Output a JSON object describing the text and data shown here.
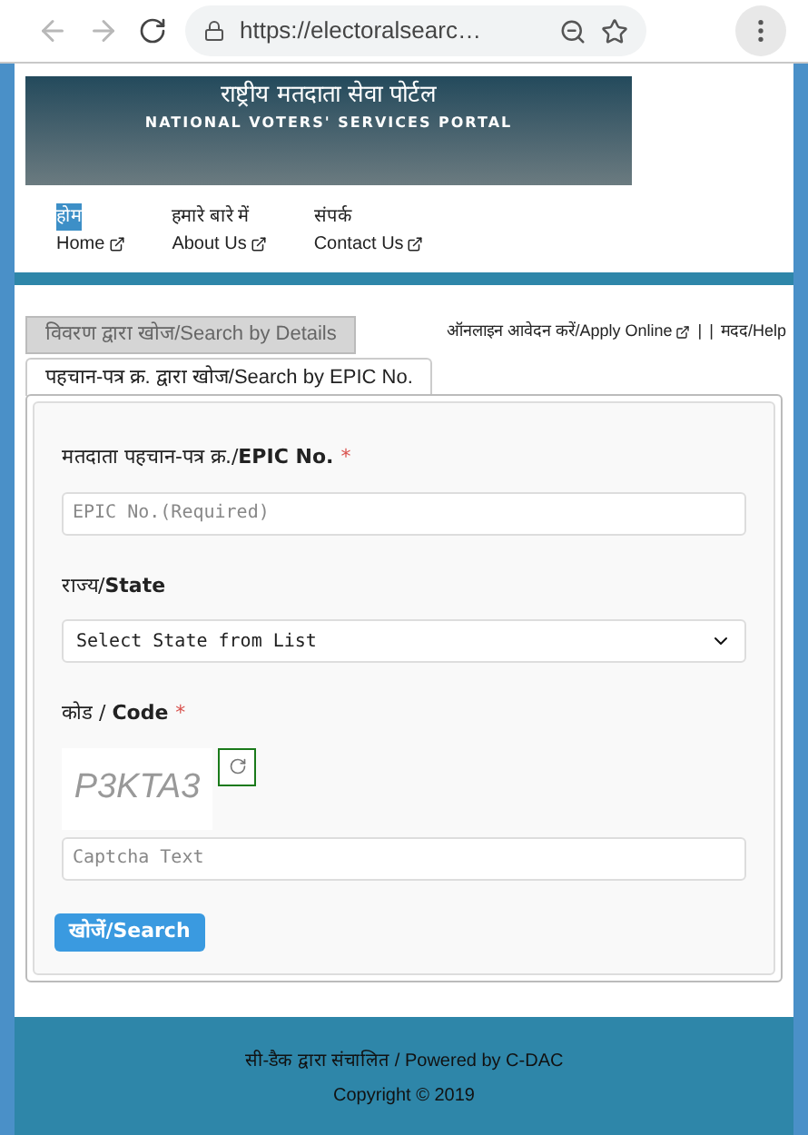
{
  "browser": {
    "url": "https://electoralsearc…",
    "back_disabled": true,
    "forward_disabled": true
  },
  "banner": {
    "title_hindi": "राष्ट्रीय मतदाता सेवा पोर्टल",
    "title_english": "NATIONAL VOTERS' SERVICES PORTAL"
  },
  "nav": [
    {
      "hindi": "होम",
      "english": "Home",
      "selected": true
    },
    {
      "hindi": "हमारे बारे में",
      "english": "About Us",
      "selected": false
    },
    {
      "hindi": "संपर्क",
      "english": "Contact Us",
      "selected": false
    }
  ],
  "tabs": [
    {
      "label": "विवरण द्वारा खोज/Search by Details",
      "selected": false
    },
    {
      "label": "पहचान-पत्र क्र. द्वारा खोज/Search by EPIC No.",
      "selected": true
    }
  ],
  "top_links": [
    {
      "label": "ऑनलाइन आवेदन करें/Apply Online",
      "external": true
    },
    {
      "label": "|",
      "external": false
    },
    {
      "label": "|",
      "external": false
    },
    {
      "label": "मदद/Help",
      "external": false
    }
  ],
  "form": {
    "fields": [
      {
        "kind": "text",
        "label": "मतदाता पहचान-पत्र क्र./**EPIC No.**",
        "required_mark": "*",
        "placeholder": "EPIC No.(Required)"
      },
      {
        "kind": "select",
        "label": "राज्य/**State**",
        "value": "Select State from List"
      },
      {
        "kind": "captcha",
        "label": "कोड / **Code**",
        "required_mark": "*",
        "captcha": "P3KTA3",
        "placeholder": "Captcha Text"
      }
    ],
    "submit": "खोजें/Search"
  },
  "footer": {
    "powered_by": "सी-डैक द्वारा संचालित / Powered by C-DAC",
    "copyright": "Copyright © 2019"
  }
}
